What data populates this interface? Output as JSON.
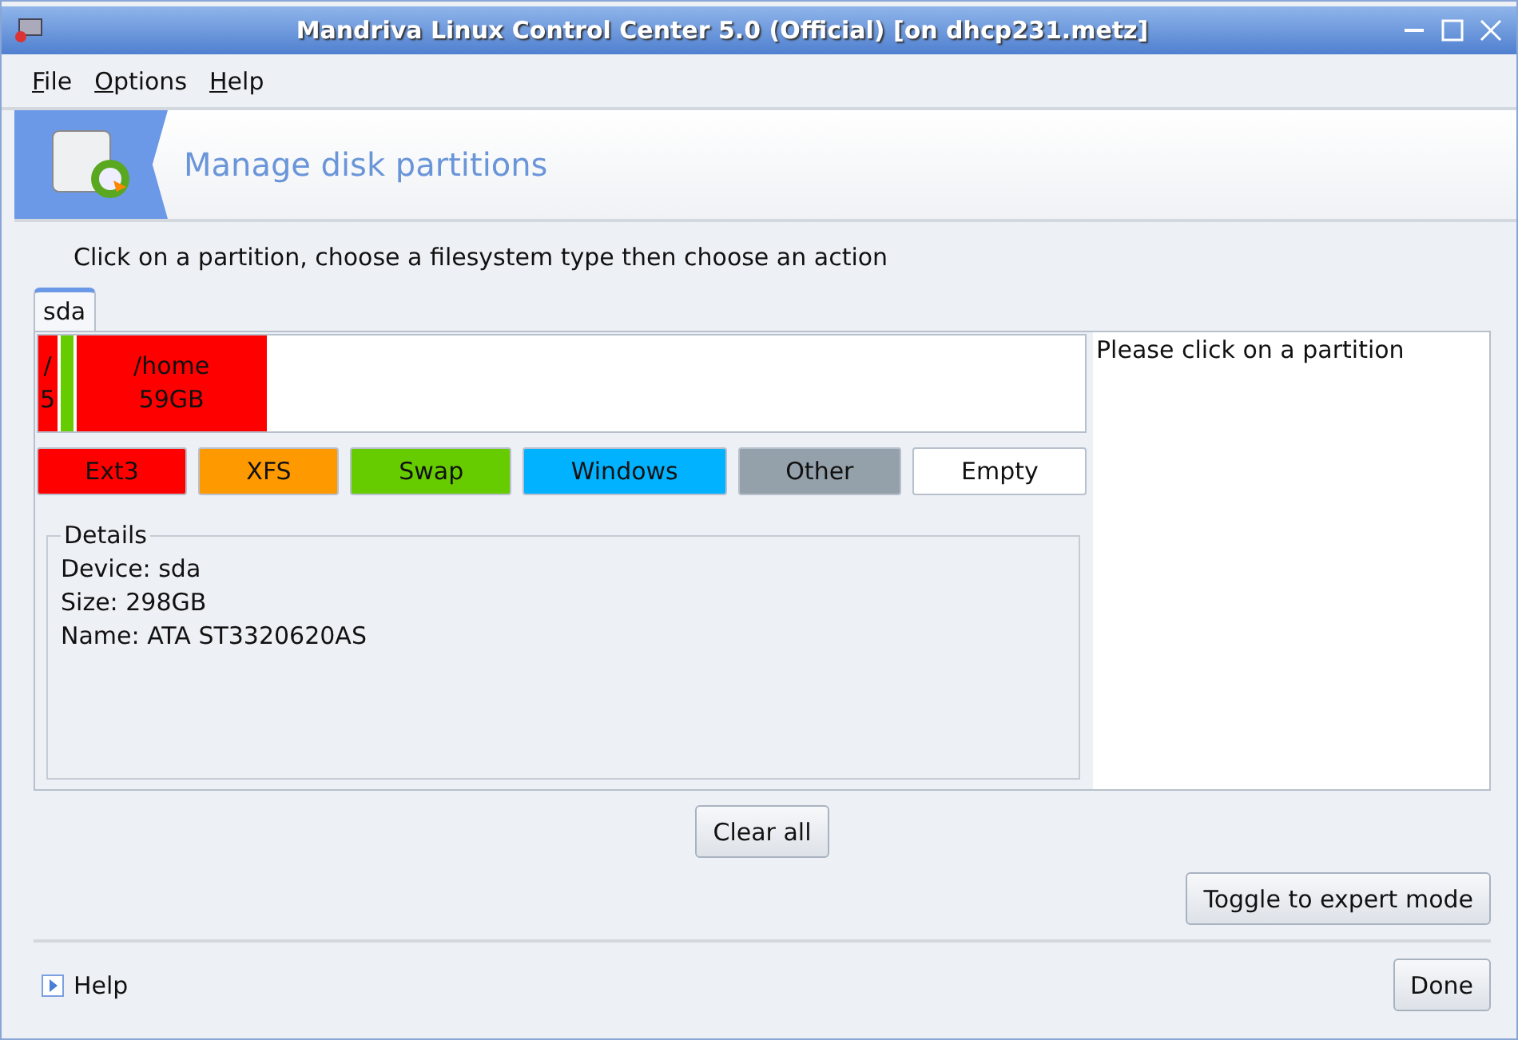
{
  "window": {
    "title": "Mandriva Linux Control Center 5.0 (Official) [on dhcp231.metz]"
  },
  "menu": [
    {
      "label": "File"
    },
    {
      "label": "Options"
    },
    {
      "label": "Help"
    }
  ],
  "banner": {
    "title": "Manage disk partitions"
  },
  "instruction": "Click on a partition, choose a filesystem type then choose an action",
  "tabs": [
    {
      "label": "sda",
      "selected": true
    }
  ],
  "partitions": [
    {
      "lines": [
        "/",
        "5"
      ],
      "color": "#ff0000",
      "kind": "used"
    },
    {
      "color": "#66cc00",
      "kind": "used"
    },
    {
      "lines": [
        "/home",
        "59GB"
      ],
      "color": "#ff0000",
      "kind": "used"
    },
    {
      "color": "#ffffff",
      "kind": "free"
    }
  ],
  "legend": [
    {
      "label": "Ext3",
      "color": "#ff0000"
    },
    {
      "label": "XFS",
      "color": "#ff9900"
    },
    {
      "label": "Swap",
      "color": "#66cc00"
    },
    {
      "label": "Windows",
      "color": "#00b2ff"
    },
    {
      "label": "Other",
      "color": "#94a0aa"
    },
    {
      "label": "Empty",
      "color": "#ffffff"
    }
  ],
  "details": {
    "title": "Details",
    "lines": [
      "Device: sda",
      "Size: 298GB",
      "Name: ATA ST3320620AS"
    ]
  },
  "info_panel": {
    "text": "Please click on a partition"
  },
  "buttons": {
    "clear": "Clear all",
    "expert": "Toggle to expert mode",
    "done": "Done"
  },
  "footer": {
    "help": "Help"
  }
}
